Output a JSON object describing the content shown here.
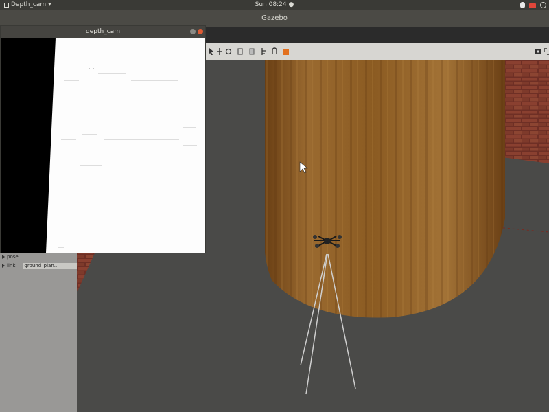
{
  "top_panel": {
    "app_name": "Depth_cam",
    "app_dropdown": "▾",
    "clock": "Sun 08:24 ●"
  },
  "gazebo": {
    "window_title": "Gazebo"
  },
  "depth_cam_window": {
    "title": "depth_cam"
  },
  "left_panel": {
    "rows": [
      {
        "label": "pose",
        "value": ""
      },
      {
        "label": "link",
        "value": "ground_plan..."
      }
    ]
  },
  "icons": {
    "power": "power-icon",
    "camera": "camera-icon",
    "screenshot": "screenshot-icon",
    "fullscreen": "fullscreen-icon"
  },
  "colors": {
    "barrel": "#8a5a24",
    "floor": "#4a4a48",
    "brick": "#7a3a2a"
  }
}
